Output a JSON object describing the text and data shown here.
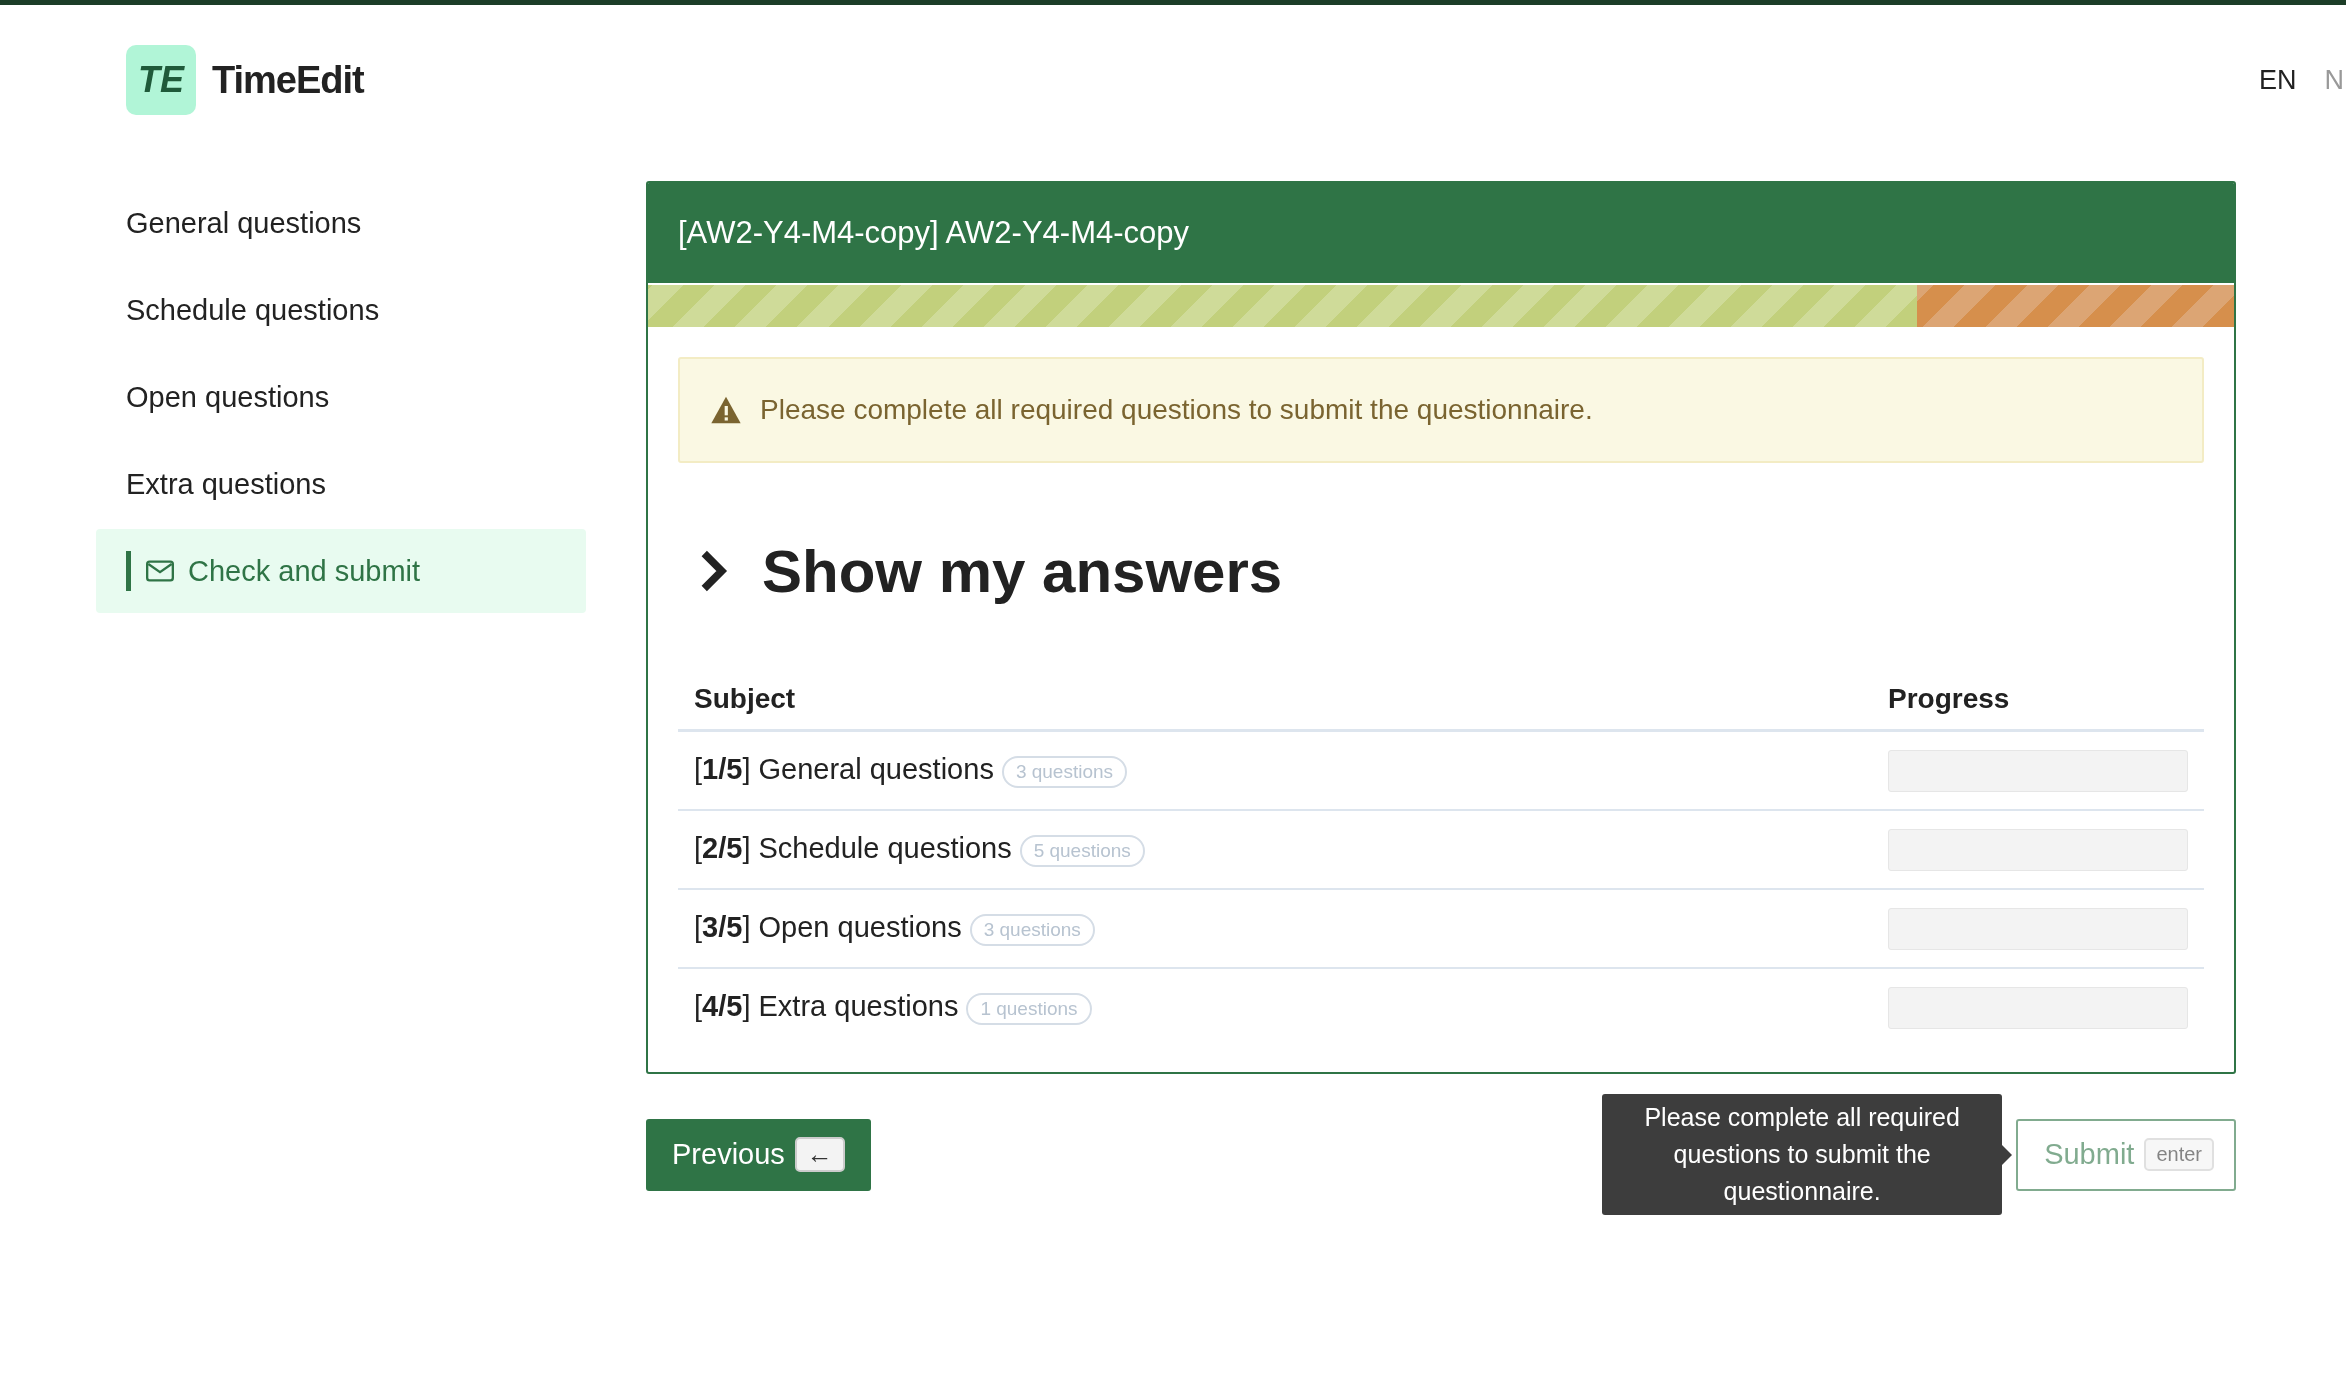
{
  "header": {
    "brand": "TimeEdit",
    "logo_text": "TE",
    "languages": [
      {
        "label": "EN",
        "selected": true
      },
      {
        "label": "N",
        "selected": false
      }
    ]
  },
  "sidebar": {
    "items": [
      {
        "label": "General questions",
        "selected": false
      },
      {
        "label": "Schedule questions",
        "selected": false
      },
      {
        "label": "Open questions",
        "selected": false
      },
      {
        "label": "Extra questions",
        "selected": false
      },
      {
        "label": "Check and submit",
        "selected": true
      }
    ]
  },
  "card": {
    "title": "[AW2-Y4-M4-copy] AW2-Y4-M4-copy",
    "progress": {
      "level": 0.8
    },
    "alert": "Please complete all required questions to submit the questionnaire.",
    "section_title": "Show my answers",
    "section_expanded": false,
    "table": {
      "columns": [
        "Subject",
        "Progress"
      ],
      "rows": [
        {
          "subject": "[**1/5**] General questions",
          "count": "3 questions",
          "level": 0
        },
        {
          "subject": "[**2/5**] Schedule questions",
          "count": "5 questions",
          "level": 0
        },
        {
          "subject": "[**3/5**] Open questions",
          "count": "3 questions",
          "level": 0
        },
        {
          "subject": "[**4/5**] Extra questions",
          "count": "1 questions",
          "level": 0
        }
      ]
    }
  },
  "footer": {
    "previous": {
      "label": "Previous",
      "key": "←"
    },
    "tooltip": "Please complete all required questions to submit the questionnaire.",
    "submit": {
      "label": "Submit",
      "key": "enter",
      "disabled": true
    }
  }
}
